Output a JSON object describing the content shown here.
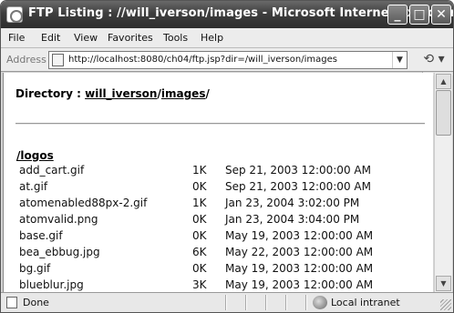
{
  "window": {
    "title": "FTP Listing : //will_iverson/images - Microsoft Internet Explorer"
  },
  "title_buttons": {
    "minimize": "_",
    "maximize": "□",
    "close": "✕"
  },
  "menu": {
    "items": [
      {
        "label": "File"
      },
      {
        "label": "Edit"
      },
      {
        "label": "View"
      },
      {
        "label": "Favorites"
      },
      {
        "label": "Tools"
      },
      {
        "label": "Help"
      }
    ]
  },
  "address": {
    "label": "Address",
    "url": "http://localhost:8080/ch04/ftp.jsp?dir=/will_iverson/images",
    "dropdown": "▼",
    "go": "⟲ ▾"
  },
  "content": {
    "directory_label": "Directory : ",
    "path_parts": [
      "will_iverson",
      "/",
      "images",
      "/"
    ],
    "folder_link": "/logos",
    "files": [
      {
        "name": "add_cart.gif",
        "size": "1K",
        "date": "Sep 21, 2003 12:00:00 AM"
      },
      {
        "name": "at.gif",
        "size": "0K",
        "date": "Sep 21, 2003 12:00:00 AM"
      },
      {
        "name": "atomenabled88px-2.gif",
        "size": "1K",
        "date": "Jan 23, 2004 3:02:00 PM"
      },
      {
        "name": "atomvalid.png",
        "size": "0K",
        "date": "Jan 23, 2004 3:04:00 PM"
      },
      {
        "name": "base.gif",
        "size": "0K",
        "date": "May 19, 2003 12:00:00 AM"
      },
      {
        "name": "bea_ebbug.jpg",
        "size": "6K",
        "date": "May 22, 2003 12:00:00 AM"
      },
      {
        "name": "bg.gif",
        "size": "0K",
        "date": "May 19, 2003 12:00:00 AM"
      },
      {
        "name": "blueblur.jpg",
        "size": "3K",
        "date": "May 19, 2003 12:00:00 AM"
      }
    ]
  },
  "scrollbar": {
    "up": "▲",
    "down": "▼"
  },
  "status": {
    "text": "Done",
    "zone": "Local intranet"
  }
}
